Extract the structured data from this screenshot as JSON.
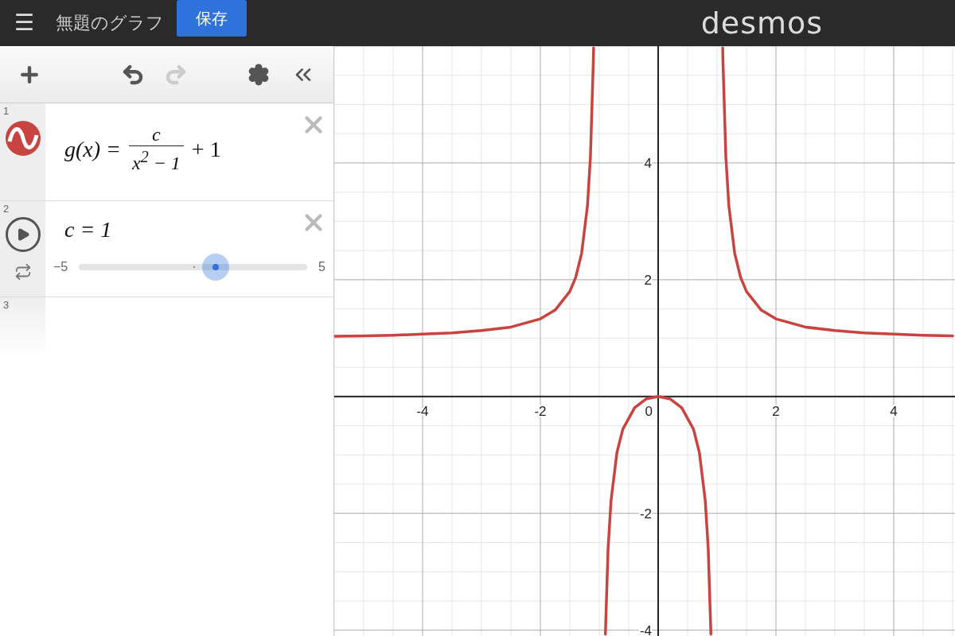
{
  "header": {
    "menu": "☰",
    "title": "無題のグラフ",
    "save_button": "保存",
    "logo": "desmos"
  },
  "expressions": [
    {
      "index": "1",
      "kind": "function",
      "lhs": "g(x) =",
      "numerator": "c",
      "denominator": "x$^{2}$ − 1",
      "tail": "+ 1",
      "color": "#c74440"
    },
    {
      "index": "2",
      "kind": "slider",
      "text": "c = 1",
      "min": "−5",
      "max": "5",
      "level": 0.6
    },
    {
      "index": "3",
      "kind": "empty"
    }
  ],
  "graph": {
    "origin_label": "0",
    "chart_data": {
      "type": "line",
      "grid": true,
      "xlim": [
        -5.5,
        5.04
      ],
      "ylim": [
        -4.1,
        6
      ],
      "xticks": [
        -4,
        -2,
        2,
        4
      ],
      "yticks": [
        -4,
        -2,
        2,
        4
      ],
      "x": [
        -5.5,
        -5,
        -4.5,
        -4,
        -3.5,
        -3,
        -2.5,
        -2,
        -1.75,
        -1.5,
        -1.4,
        -1.3,
        -1.2,
        -1.15,
        -1.1,
        -1.096,
        -1,
        -0.896,
        -0.85,
        -0.8,
        -0.7,
        -0.6,
        -0.4,
        -0.2,
        0,
        0.2,
        0.4,
        0.6,
        0.7,
        0.8,
        0.85,
        0.896,
        1,
        1.096,
        1.1,
        1.15,
        1.2,
        1.3,
        1.4,
        1.5,
        1.75,
        2,
        2.5,
        3,
        3.5,
        4,
        4.5,
        5
      ],
      "series": [
        {
          "color": "#c74440",
          "values": [
            1.03,
            1.04,
            1.05,
            1.07,
            1.09,
            1.13,
            1.19,
            1.33,
            1.48,
            1.8,
            2.04,
            2.45,
            3.27,
            4.1,
            5.76,
            5.97,
            null,
            -4.07,
            -2.6,
            -1.78,
            -0.96,
            -0.56,
            -0.19,
            -0.04,
            0,
            -0.04,
            -0.19,
            -0.56,
            -0.96,
            -1.78,
            -2.6,
            -4.07,
            null,
            5.97,
            5.76,
            4.1,
            3.27,
            2.45,
            2.04,
            1.8,
            1.48,
            1.33,
            1.19,
            1.13,
            1.09,
            1.07,
            1.05,
            1.04
          ]
        }
      ]
    }
  }
}
